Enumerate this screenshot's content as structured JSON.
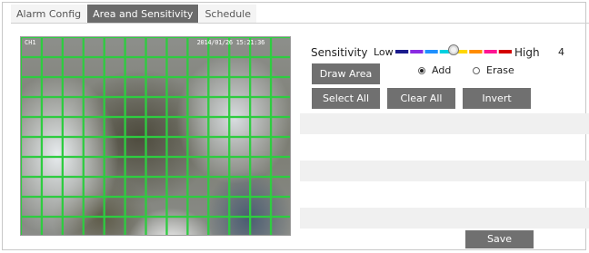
{
  "tabs": [
    {
      "label": "Alarm Config",
      "active": false
    },
    {
      "label": "Area and Sensitivity",
      "active": true
    },
    {
      "label": "Schedule",
      "active": false
    }
  ],
  "preview": {
    "channel_osd": "CH1",
    "timestamp_osd": "2014/01/26 15:21:36",
    "grid": {
      "columns": 13,
      "rows": 10,
      "all_selected": true,
      "line_color": "#2ecc40"
    }
  },
  "sensitivity": {
    "label": "Sensitivity",
    "low_label": "Low",
    "high_label": "High",
    "value": "4",
    "level": 4,
    "max_level": 8,
    "segment_colors": [
      "#1a1a8c",
      "#8a2be2",
      "#1e90ff",
      "#00d0e0",
      "#ffd700",
      "#ff8c00",
      "#ff1493",
      "#d40000"
    ]
  },
  "buttons": {
    "draw_area": "Draw Area",
    "select_all": "Select All",
    "clear_all": "Clear All",
    "invert": "Invert",
    "save": "Save"
  },
  "draw_mode": {
    "selected": "add",
    "add_label": "Add",
    "erase_label": "Erase"
  }
}
